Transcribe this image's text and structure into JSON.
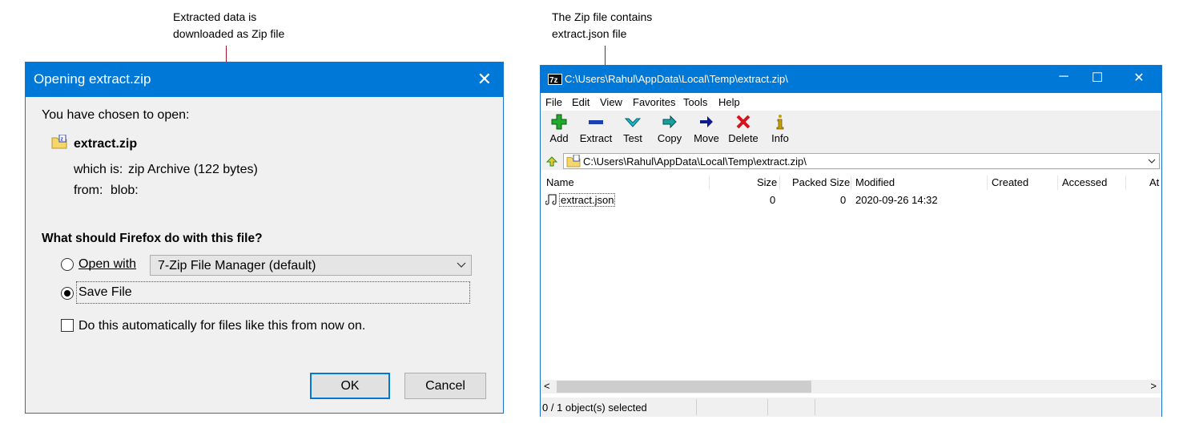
{
  "callouts": {
    "left": [
      "Extracted data is",
      "downloaded as Zip file"
    ],
    "right": [
      "The Zip file contains",
      "extract.json file"
    ]
  },
  "firefox_dialog": {
    "title": "Opening extract.zip",
    "close_glyph": "✕",
    "intro": "You have chosen to open:",
    "file_name": "extract.zip",
    "which_is_label": "which is:",
    "which_is_value": "zip Archive (122 bytes)",
    "from_label": "from:",
    "from_value": "blob:",
    "question": "What should Firefox do with this file?",
    "open_with_label": "Open with",
    "open_with_value": "7-Zip File Manager (default)",
    "open_with_selected": false,
    "save_file_label": "Save File",
    "save_file_selected": true,
    "auto_checkbox_label": "Do this automatically for files like this from now on.",
    "auto_checked": false,
    "ok_label": "OK",
    "cancel_label": "Cancel"
  },
  "sevenzip": {
    "title": "C:\\Users\\Rahul\\AppData\\Local\\Temp\\extract.zip\\",
    "menu": [
      "File",
      "Edit",
      "View",
      "Favorites",
      "Tools",
      "Help"
    ],
    "toolbar": [
      {
        "label": "Add",
        "icon": "plus-icon",
        "color": "#22a82a"
      },
      {
        "label": "Extract",
        "icon": "minus-icon",
        "color": "#1a3fb0"
      },
      {
        "label": "Test",
        "icon": "check-icon",
        "color": "#19b8c8"
      },
      {
        "label": "Copy",
        "icon": "copy-arrow-icon",
        "color": "#18a0a0"
      },
      {
        "label": "Move",
        "icon": "move-arrow-icon",
        "color": "#101a8c"
      },
      {
        "label": "Delete",
        "icon": "x-icon",
        "color": "#d6141c"
      },
      {
        "label": "Info",
        "icon": "info-icon",
        "color": "#c8a000"
      }
    ],
    "address": "C:\\Users\\Rahul\\AppData\\Local\\Temp\\extract.zip\\",
    "columns": [
      "Name",
      "Size",
      "Packed Size",
      "Modified",
      "Created",
      "Accessed",
      "At"
    ],
    "rows": [
      {
        "name": "extract.json",
        "size": "0",
        "packed": "0",
        "modified": "2020-09-26 14:32"
      }
    ],
    "status": "0 / 1 object(s) selected"
  }
}
